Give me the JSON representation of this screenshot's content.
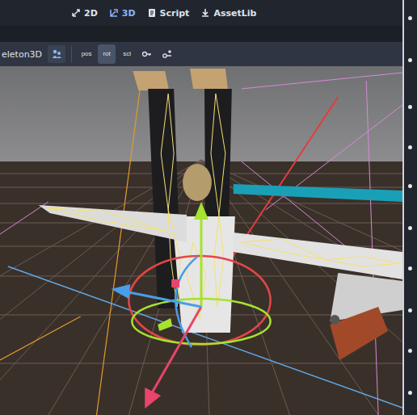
{
  "editor_tabs": [
    {
      "label": "2D",
      "kind": "2d",
      "selected": false
    },
    {
      "label": "3D",
      "kind": "3d",
      "selected": true
    },
    {
      "label": "Script",
      "kind": "script",
      "selected": false
    },
    {
      "label": "AssetLib",
      "kind": "assetlib",
      "selected": false
    }
  ],
  "toolbar": {
    "node": "eleton3D",
    "tools": [
      {
        "label": "pos",
        "selected": false
      },
      {
        "label": "rot",
        "selected": true
      },
      {
        "label": "scl",
        "selected": false
      }
    ]
  }
}
